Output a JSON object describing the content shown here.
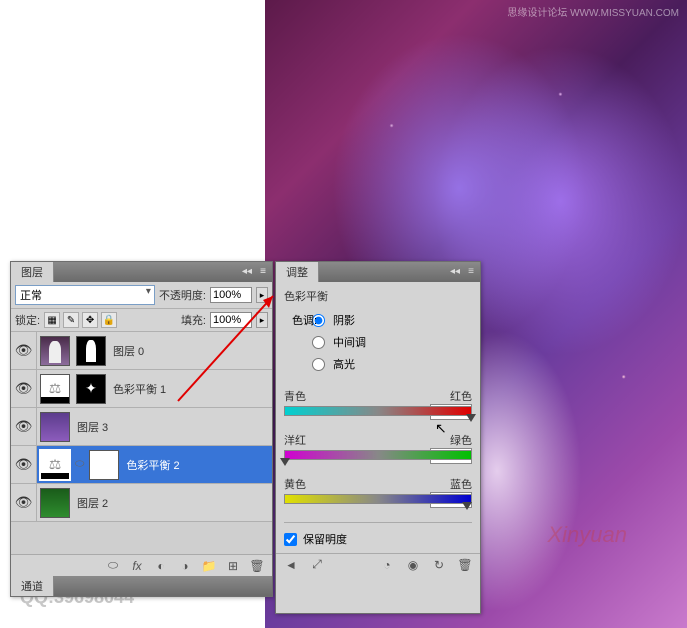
{
  "watermark_top": "思缘设计论坛 WWW.MISSYUAN.COM",
  "watermark_bottom": "Xinyuan",
  "qq_text": "QQ:39698044",
  "layers_panel": {
    "tab": "图层",
    "channels_tab": "通道",
    "blend_mode": "正常",
    "opacity_label": "不透明度:",
    "opacity_value": "100%",
    "lock_label": "锁定:",
    "fill_label": "填充:",
    "fill_value": "100%",
    "layers": [
      {
        "name": "图层 0",
        "type": "figure",
        "mask": "figure-mask",
        "selected": false
      },
      {
        "name": "色彩平衡 1",
        "type": "adjust",
        "mask": "butterfly",
        "selected": false
      },
      {
        "name": "图层 3",
        "type": "purple",
        "mask": null,
        "selected": false
      },
      {
        "name": "色彩平衡 2",
        "type": "adjust",
        "mask": "white",
        "selected": true
      },
      {
        "name": "图层 2",
        "type": "green",
        "mask": null,
        "selected": false
      }
    ]
  },
  "adjust_panel": {
    "tab": "调整",
    "title": "色彩平衡",
    "tone_label": "色调:",
    "radios": {
      "shadows": "阴影",
      "midtones": "中间调",
      "highlights": "高光",
      "selected": "shadows"
    },
    "sliders": [
      {
        "left": "青色",
        "right": "红色",
        "value": "+100",
        "pos": 100,
        "track": "cyan-red"
      },
      {
        "left": "洋红",
        "right": "绿色",
        "value": "-100",
        "pos": 0,
        "track": "mag-green"
      },
      {
        "left": "黄色",
        "right": "蓝色",
        "value": "+96",
        "pos": 98,
        "track": "yel-blue"
      }
    ],
    "preserve_label": "保留明度",
    "preserve_checked": true
  },
  "icons": {
    "eye": "👁",
    "lock": "🔒",
    "link": "⬭",
    "fx": "fx",
    "mask_btn": "◐",
    "folder": "📁",
    "adjust_btn": "◑",
    "new": "⊞",
    "trash": "🗑",
    "back": "◄",
    "view": "◉",
    "reset": "↻",
    "menu": "≡",
    "collapse": "◂◂",
    "close": "×"
  }
}
